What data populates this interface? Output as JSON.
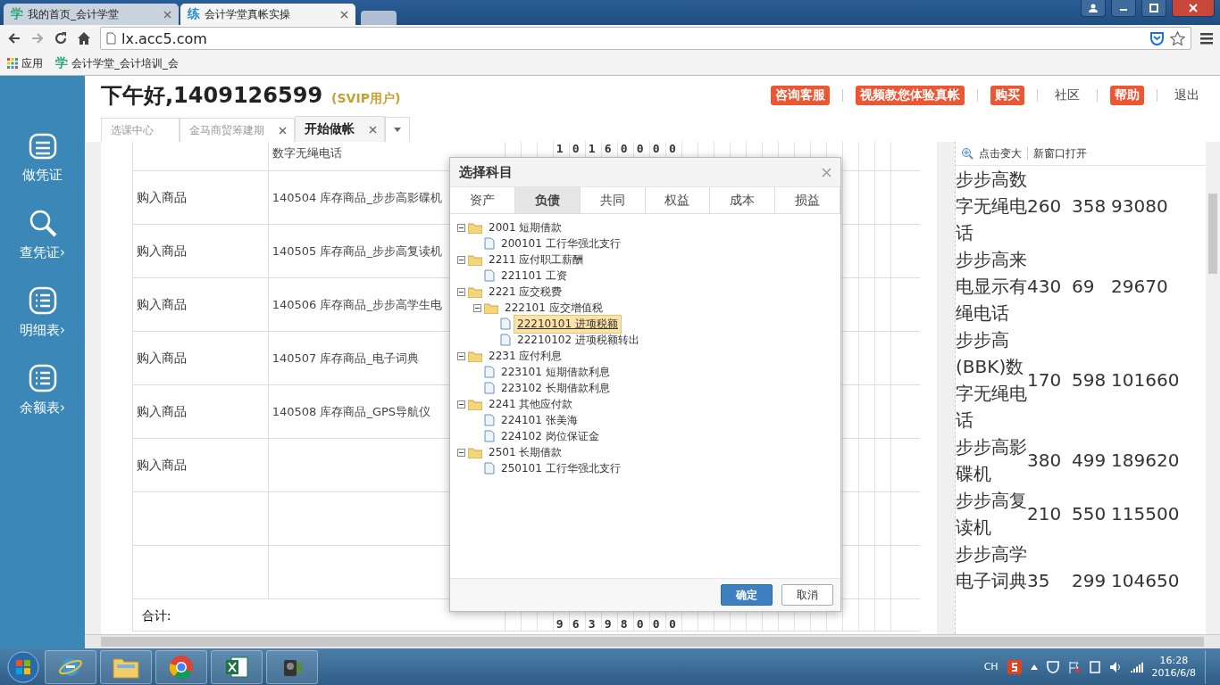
{
  "browser": {
    "tabs": [
      {
        "favicon": "学",
        "title": "我的首页_会计学堂",
        "selected": false
      },
      {
        "favicon": "练",
        "title": "会计学堂真帐实操",
        "selected": true
      }
    ],
    "address": "lx.acc5.com",
    "bookmarks": [
      {
        "kind": "apps",
        "label": "应用"
      },
      {
        "kind": "site",
        "favicon": "学",
        "label": "会计学堂_会计培训_会"
      }
    ]
  },
  "sidebar": {
    "items": [
      {
        "kind": "calendar",
        "label": "做凭证"
      },
      {
        "kind": "search",
        "label": "查凭证",
        "arrow": "›"
      },
      {
        "kind": "list",
        "label": "明细表",
        "arrow": "›"
      },
      {
        "kind": "list",
        "label": "余额表",
        "arrow": "›"
      }
    ]
  },
  "header": {
    "greeting": "下午好,1409126599",
    "level": "(SVIP用户)",
    "links": [
      {
        "kind": "badge",
        "label": "咨询客服"
      },
      {
        "kind": "badge",
        "label": "视频教您体验真帐"
      },
      {
        "kind": "badge",
        "label": "购买"
      },
      {
        "kind": "plain",
        "label": "社区"
      },
      {
        "kind": "badge",
        "label": "帮助"
      },
      {
        "kind": "plain",
        "label": "退出"
      }
    ]
  },
  "page_tabs": [
    {
      "label": "选课中心",
      "closable": false,
      "selected": false
    },
    {
      "label": "金马商贸筹建期",
      "closable": true,
      "selected": false
    },
    {
      "label": "开始做帐",
      "closable": true,
      "selected": true
    }
  ],
  "voucher": {
    "rows": [
      {
        "account": "数字无绳电话",
        "digits": "10160000"
      },
      {
        "summary": "购入商品",
        "account": "140504 库存商品_步步高影碟机"
      },
      {
        "summary": "购入商品",
        "account": "140505 库存商品_步步高复读机"
      },
      {
        "summary": "购入商品",
        "account": "140506 库存商品_步步高学生电"
      },
      {
        "summary": "购入商品",
        "account": "140507 库存商品_电子词典"
      },
      {
        "summary": "购入商品",
        "account": "140508 库存商品_GPS导航仪"
      },
      {
        "summary": "购入商品"
      },
      {},
      {}
    ],
    "total": {
      "label": "合计:",
      "digits": "96398000"
    }
  },
  "dialog": {
    "title": "选择科目",
    "tabs": [
      {
        "label": "资产",
        "selected": false
      },
      {
        "label": "负债",
        "selected": true
      },
      {
        "label": "共同",
        "selected": false
      },
      {
        "label": "权益",
        "selected": false
      },
      {
        "label": "成本",
        "selected": false
      },
      {
        "label": "损益",
        "selected": false
      }
    ],
    "tree": [
      {
        "label": "2001 短期借款",
        "expanded": true,
        "selected": false,
        "children": [
          {
            "label": "200101 工行华强北支行",
            "selected": false
          }
        ]
      },
      {
        "label": "2211 应付职工薪酬",
        "expanded": true,
        "selected": false,
        "children": [
          {
            "label": "221101 工资",
            "selected": false
          }
        ]
      },
      {
        "label": "2221 应交税费",
        "expanded": true,
        "selected": false,
        "children": [
          {
            "label": "222101 应交增值税",
            "expanded": true,
            "selected": false,
            "children": [
              {
                "label": "22210101 进项税额",
                "selected": true
              },
              {
                "label": "22210102 进项税额转出",
                "selected": false
              }
            ]
          }
        ]
      },
      {
        "label": "2231 应付利息",
        "expanded": true,
        "selected": false,
        "children": [
          {
            "label": "223101 短期借款利息",
            "selected": false
          },
          {
            "label": "223102 长期借款利息",
            "selected": false
          }
        ]
      },
      {
        "label": "2241 其他应付款",
        "expanded": true,
        "selected": false,
        "children": [
          {
            "label": "224101 张美海",
            "selected": false
          },
          {
            "label": "224102 岗位保证金",
            "selected": false
          }
        ]
      },
      {
        "label": "2501 长期借款",
        "expanded": true,
        "selected": false,
        "children": [
          {
            "label": "250101 工行华强北支行",
            "selected": false
          }
        ]
      }
    ],
    "buttons": [
      {
        "kind": "primary",
        "label": "确定"
      },
      {
        "kind": "default",
        "label": "取消"
      }
    ]
  },
  "preview": {
    "toolbar": [
      "点击变大",
      "新窗口打开"
    ],
    "rows": [
      {
        "name": "步步高数字无绳电话",
        "qty": "260",
        "price": "358",
        "amount": "93080"
      },
      {
        "name": "步步高来电显示有绳电话",
        "qty": "430",
        "price": "69",
        "amount": "29670"
      },
      {
        "name": "步步高(BBK)数字无绳电话",
        "qty": "170",
        "price": "598",
        "amount": "101660"
      },
      {
        "name": "步步高影碟机",
        "qty": "380",
        "price": "499",
        "amount": "189620"
      },
      {
        "name": "步步高复读机",
        "qty": "210",
        "price": "550",
        "amount": "115500"
      },
      {
        "name": "步步高学"
      },
      {
        "name": "电子词典",
        "qty": "35",
        "price": "299",
        "amount": "104650"
      }
    ]
  },
  "taskbar": {
    "apps": [
      {
        "kind": "ie"
      },
      {
        "kind": "explorer"
      },
      {
        "kind": "chrome"
      },
      {
        "kind": "excel"
      },
      {
        "kind": "video"
      }
    ],
    "lang": "CH",
    "time": "16:28",
    "date": "2016/6/8"
  }
}
